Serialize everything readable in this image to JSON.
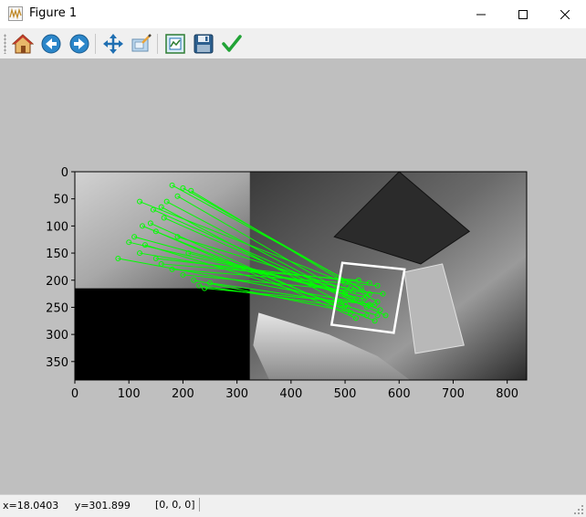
{
  "window": {
    "title": "Figure 1",
    "icons": [
      "figure-app-icon",
      "minimize-icon",
      "maximize-icon",
      "close-icon"
    ]
  },
  "toolbar": {
    "buttons": [
      {
        "icon": "home-icon"
      },
      {
        "icon": "back-arrow-icon"
      },
      {
        "icon": "forward-arrow-icon"
      },
      {
        "icon": "pan-move-icon"
      },
      {
        "icon": "zoom-rectangle-icon"
      },
      {
        "icon": "configure-subplots-icon"
      },
      {
        "icon": "save-floppy-icon"
      },
      {
        "icon": "edit-checkmark-icon"
      }
    ]
  },
  "figure": {
    "background": "#bfbfbf",
    "match_line_color": "#00ff00",
    "box_color": "#ffffff",
    "x_ticks": [
      {
        "value": 0,
        "label": "0"
      },
      {
        "value": 100,
        "label": "100"
      },
      {
        "value": 200,
        "label": "200"
      },
      {
        "value": 300,
        "label": "300"
      },
      {
        "value": 400,
        "label": "400"
      },
      {
        "value": 500,
        "label": "500"
      },
      {
        "value": 600,
        "label": "600"
      },
      {
        "value": 700,
        "label": "700"
      },
      {
        "value": 800,
        "label": "800"
      }
    ],
    "y_ticks": [
      {
        "value": 0,
        "label": "0"
      },
      {
        "value": 50,
        "label": "50"
      },
      {
        "value": 100,
        "label": "100"
      },
      {
        "value": 150,
        "label": "150"
      },
      {
        "value": 200,
        "label": "200"
      },
      {
        "value": 250,
        "label": "250"
      },
      {
        "value": 300,
        "label": "300"
      },
      {
        "value": 350,
        "label": "350"
      }
    ],
    "x_range": [
      0,
      836
    ],
    "y_range": [
      0,
      384
    ],
    "left_image": {
      "width": 324,
      "height": 384,
      "content_height": 215
    },
    "query_box": [
      [
        495,
        168
      ],
      [
        610,
        180
      ],
      [
        590,
        297
      ],
      [
        475,
        282
      ]
    ],
    "matches": [
      [
        [
          180,
          25
        ],
        [
          530,
          215
        ]
      ],
      [
        [
          200,
          30
        ],
        [
          545,
          225
        ]
      ],
      [
        [
          215,
          35
        ],
        [
          560,
          240
        ]
      ],
      [
        [
          190,
          45
        ],
        [
          520,
          235
        ]
      ],
      [
        [
          170,
          55
        ],
        [
          540,
          250
        ]
      ],
      [
        [
          160,
          65
        ],
        [
          500,
          245
        ]
      ],
      [
        [
          145,
          70
        ],
        [
          565,
          255
        ]
      ],
      [
        [
          165,
          85
        ],
        [
          575,
          265
        ]
      ],
      [
        [
          140,
          95
        ],
        [
          510,
          260
        ]
      ],
      [
        [
          125,
          100
        ],
        [
          555,
          275
        ]
      ],
      [
        [
          150,
          110
        ],
        [
          520,
          270
        ]
      ],
      [
        [
          110,
          120
        ],
        [
          500,
          225
        ]
      ],
      [
        [
          100,
          130
        ],
        [
          540,
          230
        ]
      ],
      [
        [
          130,
          135
        ],
        [
          560,
          265
        ]
      ],
      [
        [
          120,
          150
        ],
        [
          510,
          215
        ]
      ],
      [
        [
          150,
          160
        ],
        [
          545,
          205
        ]
      ],
      [
        [
          160,
          170
        ],
        [
          525,
          200
        ]
      ],
      [
        [
          180,
          180
        ],
        [
          560,
          210
        ]
      ],
      [
        [
          200,
          190
        ],
        [
          570,
          225
        ]
      ],
      [
        [
          220,
          200
        ],
        [
          540,
          265
        ]
      ],
      [
        [
          230,
          210
        ],
        [
          505,
          250
        ]
      ],
      [
        [
          240,
          215
        ],
        [
          555,
          245
        ]
      ],
      [
        [
          250,
          205
        ],
        [
          490,
          240
        ]
      ],
      [
        [
          210,
          150
        ],
        [
          535,
          235
        ]
      ],
      [
        [
          190,
          120
        ],
        [
          515,
          220
        ]
      ],
      [
        [
          80,
          160
        ],
        [
          545,
          245
        ]
      ],
      [
        [
          120,
          55
        ],
        [
          500,
          205
        ]
      ]
    ]
  },
  "status": {
    "coords": "x=18.0403     y=301.899",
    "pixel": "[0, 0, 0]"
  }
}
